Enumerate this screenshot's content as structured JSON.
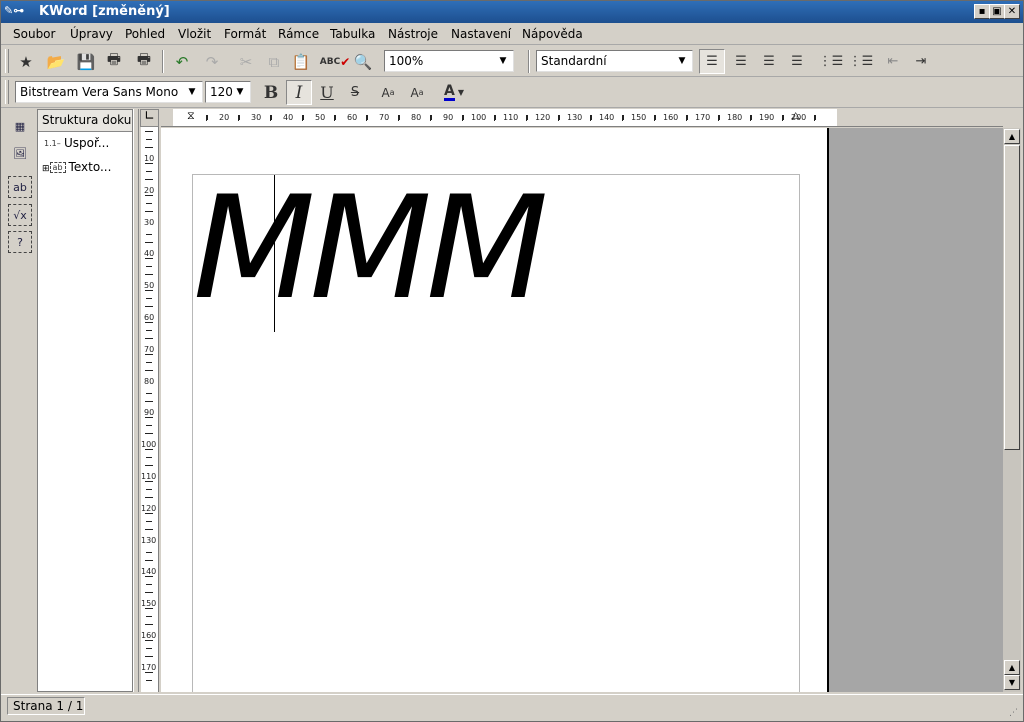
{
  "window": {
    "title": "KWord [změněný]"
  },
  "menu": [
    "Soubor",
    "Úpravy",
    "Pohled",
    "Vložit",
    "Formát",
    "Rámce",
    "Tabulka",
    "Nástroje",
    "Nastavení",
    "Nápověda"
  ],
  "toolbar1": {
    "zoom_value": "100%",
    "style_value": "Standardní",
    "spell_label": "ABC"
  },
  "toolbar2": {
    "font_value": "Bitstream Vera Sans Mono",
    "size_value": "120",
    "bold_label": "B",
    "italic_label": "I",
    "underline_label": "U",
    "strike_label": "S",
    "color_label": "A"
  },
  "structure": {
    "header": "Struktura doku",
    "items": [
      {
        "label": "Uspoř..."
      },
      {
        "label": "Texto..."
      }
    ]
  },
  "rulers": {
    "horizontal": [
      "10",
      "20",
      "30",
      "40",
      "50",
      "60",
      "70",
      "80",
      "90",
      "100",
      "110",
      "120",
      "130",
      "140",
      "150",
      "160",
      "170",
      "180",
      "190",
      "200"
    ],
    "vertical": [
      "10",
      "20",
      "30",
      "40",
      "50",
      "60",
      "70",
      "80",
      "90",
      "100",
      "110",
      "120",
      "130",
      "140",
      "150",
      "160",
      "170"
    ]
  },
  "document": {
    "text": "MMM"
  },
  "status": {
    "page": "Strana 1 / 1"
  },
  "colors": {
    "titlebar": "#1d4f8f",
    "chrome": "#d4d0c8",
    "canvas": "#a6a6a6"
  }
}
